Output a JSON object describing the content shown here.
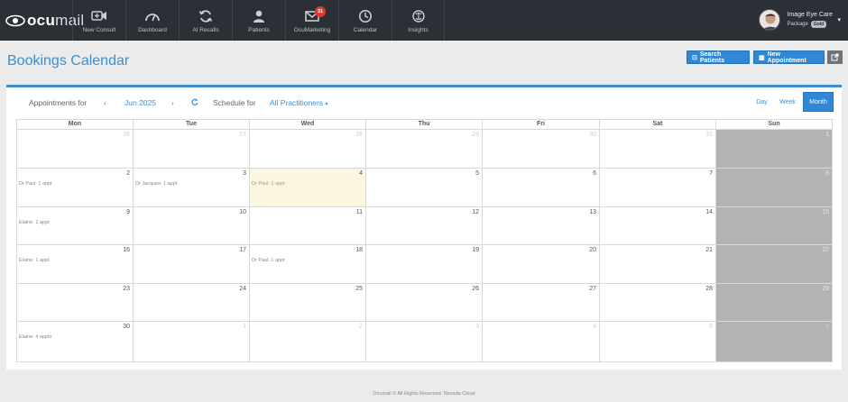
{
  "brand": {
    "logo_bold": "ocu",
    "logo_light": "mail"
  },
  "nav": [
    {
      "name": "nav-new-consult",
      "icon": "video-plus-icon",
      "label": "New Consult"
    },
    {
      "name": "nav-dashboard",
      "icon": "gauge-icon",
      "label": "Dashboard"
    },
    {
      "name": "nav-ai-recalls",
      "icon": "refresh-icon",
      "label": "AI Recalls"
    },
    {
      "name": "nav-patients",
      "icon": "person-icon",
      "label": "Patients"
    },
    {
      "name": "nav-ocumarketing",
      "icon": "envelope-icon",
      "label": "OcuMarketing",
      "badge": "31"
    },
    {
      "name": "nav-calendar",
      "icon": "clock-icon",
      "label": "Calendar"
    },
    {
      "name": "nav-insights",
      "icon": "brain-icon",
      "label": "Insights"
    }
  ],
  "user": {
    "name": "Image Eye Care",
    "package_label": "Package",
    "package_badge": "Gold"
  },
  "page": {
    "title": "Bookings Calendar",
    "search_patients": "Search Patients",
    "new_appointment": "New Appointment"
  },
  "toolbar": {
    "appointments_for": "Appointments for",
    "month": "Jun 2025",
    "schedule_for": "Schedule for",
    "practitioners": "All Practitioners",
    "views": [
      "Day",
      "Week",
      "Month"
    ],
    "active_view": "Month"
  },
  "calendar": {
    "days_of_week": [
      "Mon",
      "Tue",
      "Wed",
      "Thu",
      "Fri",
      "Sat",
      "Sun"
    ],
    "today": "4",
    "weeks": [
      [
        {
          "d": "26",
          "other": true
        },
        {
          "d": "27",
          "other": true
        },
        {
          "d": "28",
          "other": true
        },
        {
          "d": "29",
          "other": true
        },
        {
          "d": "30",
          "other": true
        },
        {
          "d": "31",
          "other": true
        },
        {
          "d": "1"
        }
      ],
      [
        {
          "d": "2",
          "appt": "Dr Paul: 1 appt"
        },
        {
          "d": "3",
          "appt": "Dr Jacques: 1 appt"
        },
        {
          "d": "4",
          "appt": "Dr Paul: 1 appt"
        },
        {
          "d": "5"
        },
        {
          "d": "6"
        },
        {
          "d": "7"
        },
        {
          "d": "8"
        }
      ],
      [
        {
          "d": "9",
          "appt": "Elaine: 1 appt"
        },
        {
          "d": "10"
        },
        {
          "d": "11"
        },
        {
          "d": "12"
        },
        {
          "d": "13"
        },
        {
          "d": "14"
        },
        {
          "d": "15"
        }
      ],
      [
        {
          "d": "16",
          "appt": "Elaine: 1 appt"
        },
        {
          "d": "17"
        },
        {
          "d": "18",
          "appt": "Dr Paul: 1 appt"
        },
        {
          "d": "19"
        },
        {
          "d": "20"
        },
        {
          "d": "21"
        },
        {
          "d": "22"
        }
      ],
      [
        {
          "d": "23"
        },
        {
          "d": "24"
        },
        {
          "d": "25"
        },
        {
          "d": "26"
        },
        {
          "d": "27"
        },
        {
          "d": "28"
        },
        {
          "d": "29"
        }
      ],
      [
        {
          "d": "30",
          "appt": "Elaine: 4 appts"
        },
        {
          "d": "1",
          "other": true
        },
        {
          "d": "2",
          "other": true
        },
        {
          "d": "3",
          "other": true
        },
        {
          "d": "4",
          "other": true
        },
        {
          "d": "5",
          "other": true
        },
        {
          "d": "6",
          "other": true
        }
      ]
    ]
  },
  "footer": "Ocumail © All Rights Reserved. Nevada Cloud",
  "colors": {
    "accent": "#2f87d6",
    "topbar": "#2b3036",
    "today": "#fbf6e2",
    "sunday": "#b3b3b3"
  }
}
